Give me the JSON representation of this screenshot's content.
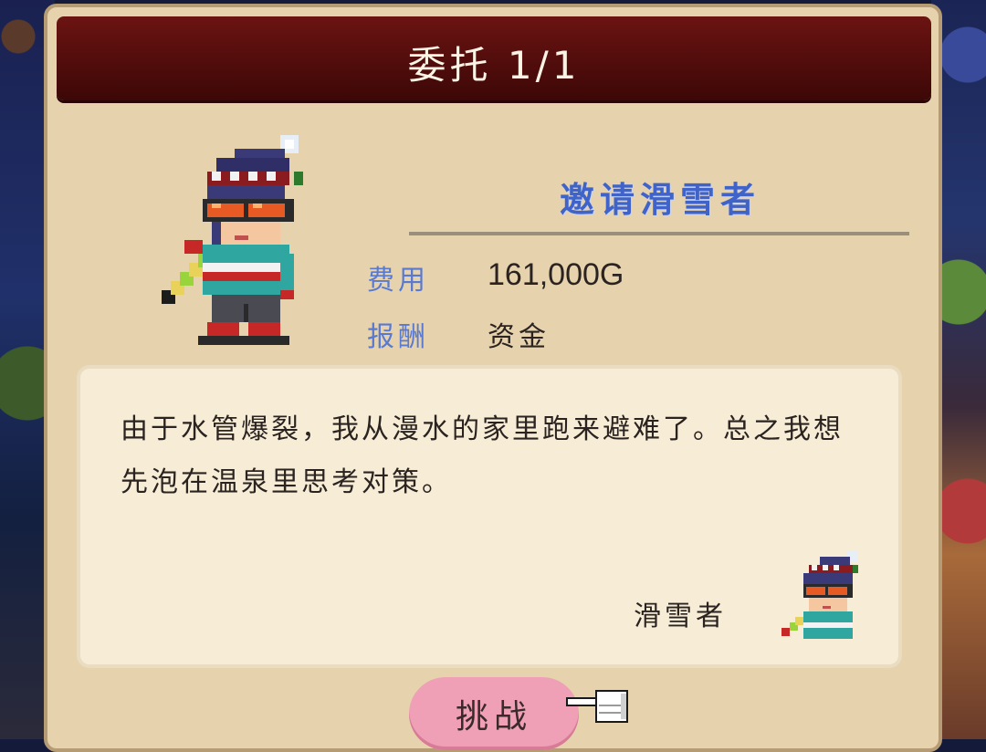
{
  "header": {
    "title": "委托 1/1"
  },
  "quest": {
    "name": "邀请滑雪者",
    "cost_label": "费用",
    "cost_value": "161,000G",
    "reward_label": "报酬",
    "reward_value": "资金"
  },
  "letter": {
    "body": "由于水管爆裂，我从漫水的家里跑来避难了。总之我想先泡在温泉里思考对策。",
    "signature": "滑雪者"
  },
  "actions": {
    "challenge_label": "挑战"
  },
  "icons": {
    "character": "skier-character-icon",
    "pointer": "hand-pointer-icon"
  },
  "colors": {
    "title_bar": "#5a0f0d",
    "panel": "#e6d3ae",
    "letter_bg": "#f7ecd6",
    "accent_blue": "#3f63c9",
    "button_pink": "#ef9fb6"
  }
}
